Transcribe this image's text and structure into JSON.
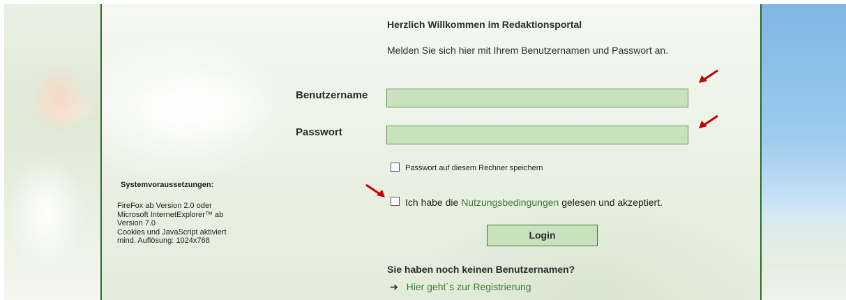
{
  "welcome": {
    "title": "Herzlich Willkommen im Redaktionsportal",
    "text": "Melden Sie sich hier mit Ihrem Benutzernamen und Passwort an."
  },
  "login_form": {
    "username_label": "Benutzername",
    "username_value": "",
    "password_label": "Passwort",
    "password_value": "",
    "remember_label": "Passwort auf diesem Rechner speichern",
    "remember_checked": false,
    "terms_prefix": "Ich habe die",
    "terms_link": "Nutzungsbedingungen",
    "terms_suffix": "gelesen und akzeptiert.",
    "terms_checked": false,
    "login_button": "Login"
  },
  "registration": {
    "title": "Sie haben noch keinen Benutzernamen?",
    "link_arrow": "➔",
    "link_text": "Hier geht`s zur Registrierung"
  },
  "system_requirements": {
    "title": "Systemvoraussetzungen:",
    "lines": [
      "FireFox ab Version 2.0 oder",
      "Microsoft InternetExplorer™ ab",
      "Version 7.0",
      "Cookies und JavaScript aktiviert",
      "mind. Auflösung: 1024x768"
    ]
  },
  "colors": {
    "field_bg": "#c8e2bd",
    "link_green": "#3d7a32",
    "border_green": "#2c6b2a",
    "arrow_red": "#c00000"
  },
  "icons": {
    "pointer_arrows": "red-arrow-icon",
    "link_arrow": "right-arrow-icon"
  }
}
